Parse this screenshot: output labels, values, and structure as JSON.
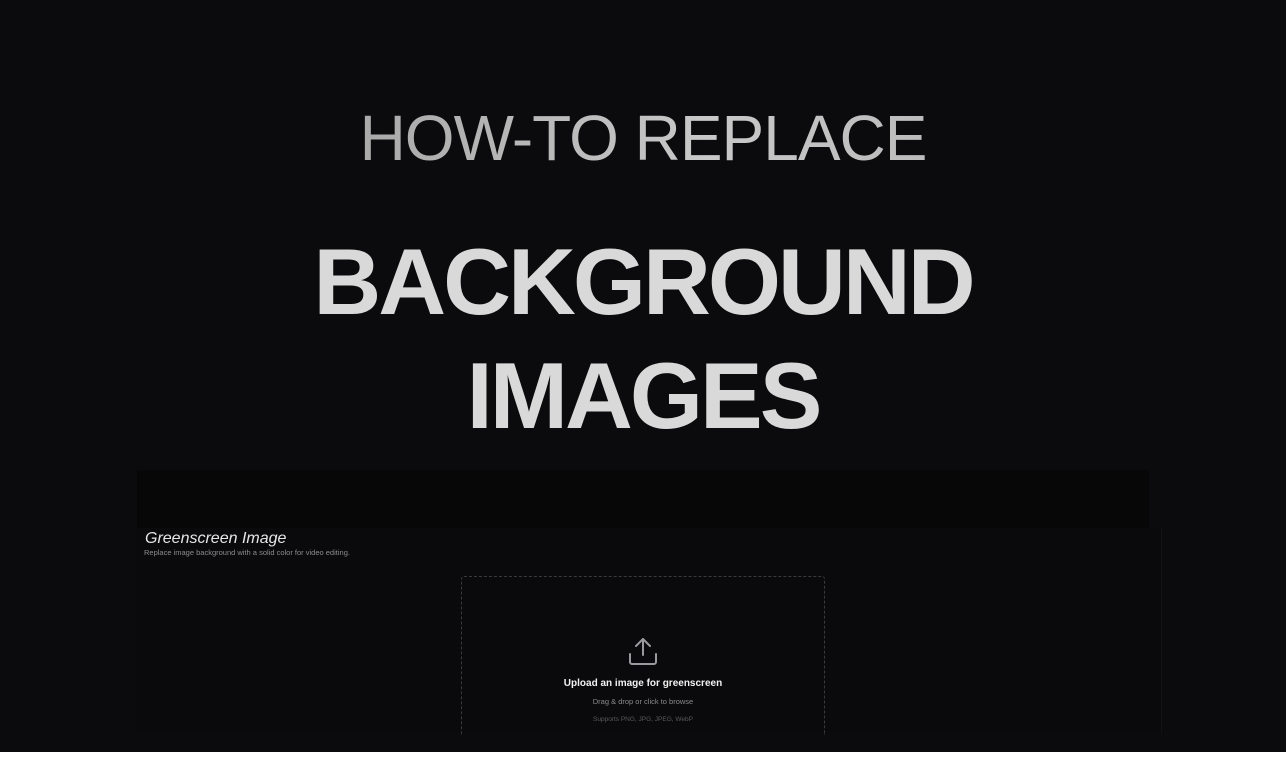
{
  "hero": {
    "eyebrow": "HOW-TO REPLACE",
    "headline_line1": "BACKGROUND",
    "headline_line2": "IMAGES"
  },
  "tool": {
    "title": "Greenscreen Image",
    "description": "Replace image background with a solid color for video editing."
  },
  "dropzone": {
    "icon": "upload-icon",
    "title": "Upload an image for greenscreen",
    "subtitle": "Drag & drop or click to browse",
    "formats": "Supports PNG, JPG, JPEG, WebP"
  },
  "colors": {
    "background": "#0b0b0d",
    "headline": "#d9d9d9",
    "eyebrow": "#a6a6a6"
  }
}
